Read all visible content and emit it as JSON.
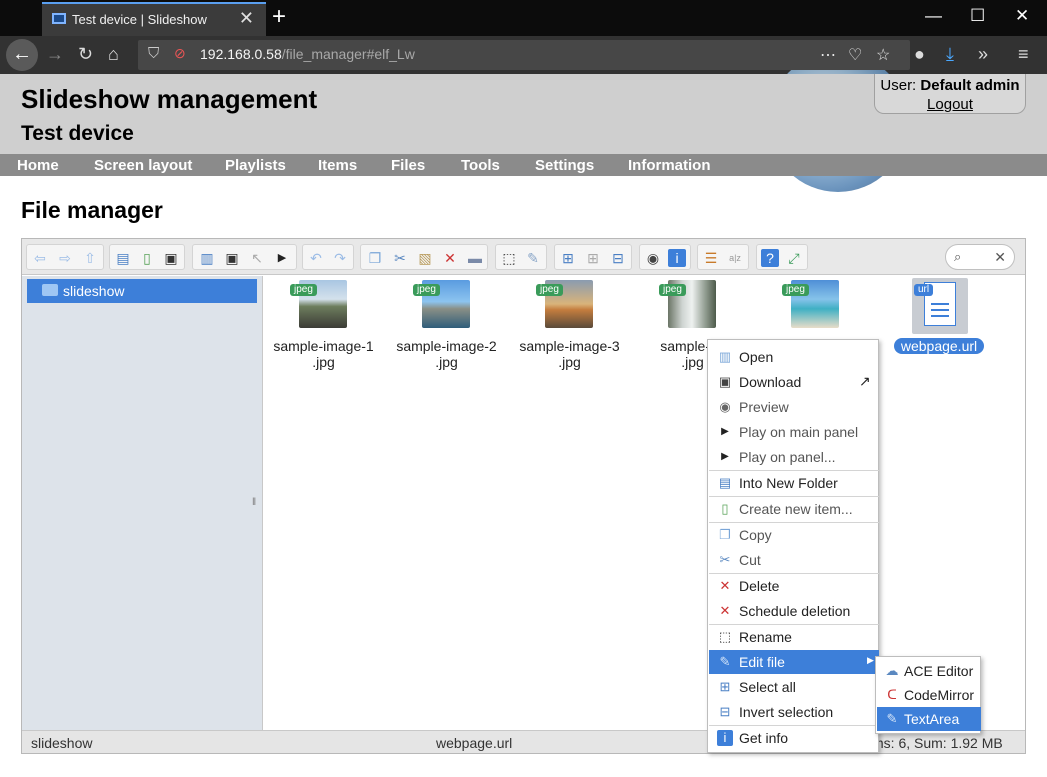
{
  "browser": {
    "tab_title": "Test device | Slideshow",
    "url_host": "192.168.0.58",
    "url_path": "/file_manager#elf_Lw"
  },
  "header": {
    "app_title": "Slideshow management",
    "device_title": "Test device",
    "user_label": "User:",
    "user_name": "Default admin",
    "logout": "Logout"
  },
  "menu": [
    "Home",
    "Screen layout",
    "Playlists",
    "Items",
    "Files",
    "Tools",
    "Settings",
    "Information"
  ],
  "page_title": "File manager",
  "tree": {
    "root": "slideshow"
  },
  "files": [
    {
      "badge": "jpeg",
      "line1": "sample-image-1",
      "line2": ".jpg"
    },
    {
      "badge": "jpeg",
      "line1": "sample-image-2",
      "line2": ".jpg"
    },
    {
      "badge": "jpeg",
      "line1": "sample-image-3",
      "line2": ".jpg"
    },
    {
      "badge": "jpeg",
      "line1": "sample-im",
      "line2": ".jpg"
    },
    {
      "badge": "jpeg",
      "line1": "",
      "line2": ""
    },
    {
      "badge": "url",
      "line1": "webpage.url",
      "line2": ""
    }
  ],
  "status": {
    "path": "slideshow",
    "selected": "webpage.url",
    "summary": "ms: 6, Sum: 1.92 MB"
  },
  "context_menu": [
    {
      "label": "Open"
    },
    {
      "label": "Download"
    },
    {
      "label": "Preview"
    },
    {
      "label": "Play on main panel"
    },
    {
      "label": "Play on panel..."
    },
    {
      "label": "Into New Folder"
    },
    {
      "label": "Create new item..."
    },
    {
      "label": "Copy"
    },
    {
      "label": "Cut"
    },
    {
      "label": "Delete"
    },
    {
      "label": "Schedule deletion"
    },
    {
      "label": "Rename"
    },
    {
      "label": "Edit file"
    },
    {
      "label": "Select all"
    },
    {
      "label": "Invert selection"
    },
    {
      "label": "Get info"
    }
  ],
  "submenu": [
    {
      "label": "ACE Editor"
    },
    {
      "label": "CodeMirror"
    },
    {
      "label": "TextArea"
    }
  ],
  "colors": {
    "accent": "#3d7fd9",
    "header_bg": "#cfcfcf",
    "menu_bg": "#8b8b8b",
    "tree_bg": "#dde3ea"
  }
}
